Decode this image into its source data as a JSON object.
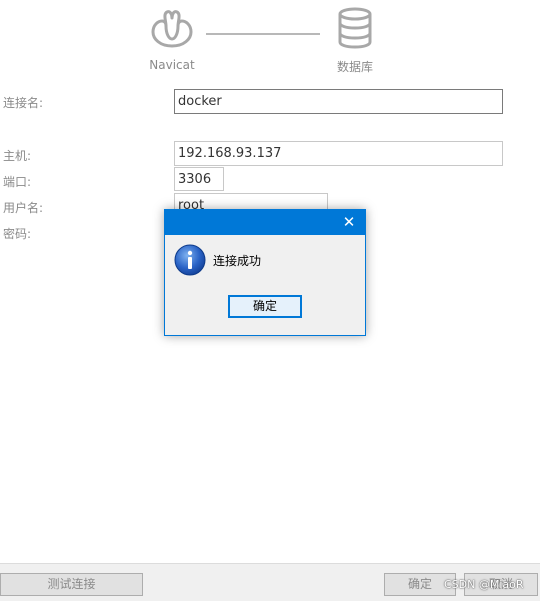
{
  "header": {
    "navicat_label": "Navicat",
    "database_label": "数据库"
  },
  "form": {
    "connection_name": {
      "label": "连接名:",
      "value": "docker"
    },
    "host": {
      "label": "主机:",
      "value": "192.168.93.137"
    },
    "port": {
      "label": "端口:",
      "value": "3306"
    },
    "username": {
      "label": "用户名:",
      "value": "root"
    },
    "password": {
      "label": "密码:"
    }
  },
  "footer": {
    "test_connection_label": "测试连接",
    "ok_label": "确定",
    "cancel_label": "取消",
    "watermark": "CSDN @MiaoR"
  },
  "dialog": {
    "message": "连接成功",
    "ok_label": "确定",
    "close_symbol": "✕",
    "icon": "info-icon"
  },
  "colors": {
    "accent": "#0078d7",
    "label_gray": "#8a8a8a"
  }
}
